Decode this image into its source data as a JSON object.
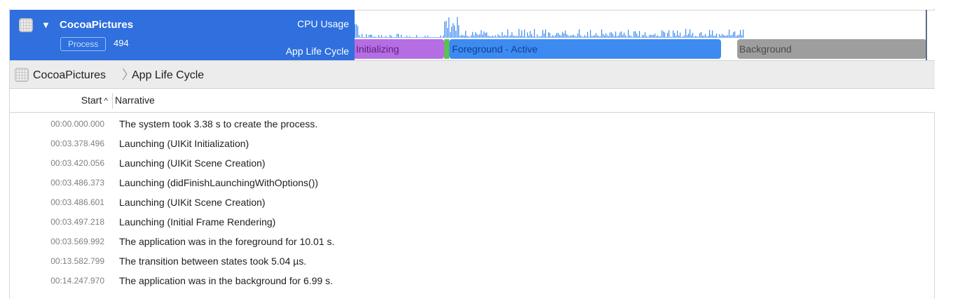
{
  "track": {
    "process_name": "CocoaPictures",
    "process_badge": "Process",
    "pid": "494",
    "cpu_lane_label": "CPU Usage",
    "lifecycle_lane_label": "App Life Cycle",
    "segments": {
      "initializing": "Initializing",
      "foreground": "Foreground - Active",
      "background": "Background"
    }
  },
  "breadcrumb": {
    "items": [
      "CocoaPictures",
      "App Life Cycle"
    ],
    "separator": "〉"
  },
  "table": {
    "columns": {
      "start": "Start",
      "narrative": "Narrative"
    },
    "sort_indicator": "^",
    "rows": [
      {
        "start": "00:00.000.000",
        "narrative": "The system took 3.38 s to create the process."
      },
      {
        "start": "00:03.378.496",
        "narrative": "Launching (UIKit Initialization)"
      },
      {
        "start": "00:03.420.056",
        "narrative": "Launching (UIKit Scene Creation)"
      },
      {
        "start": "00:03.486.373",
        "narrative": "Launching (didFinishLaunchingWithOptions())"
      },
      {
        "start": "00:03.486.601",
        "narrative": "Launching (UIKit Scene Creation)"
      },
      {
        "start": "00:03.497.218",
        "narrative": "Launching (Initial Frame Rendering)"
      },
      {
        "start": "00:03.569.992",
        "narrative": "The application was in the foreground for 10.01 s."
      },
      {
        "start": "00:13.582.799",
        "narrative": "The transition between states took 5.04 µs."
      },
      {
        "start": "00:14.247.970",
        "narrative": "The application was in the background for 6.99 s."
      }
    ]
  },
  "colors": {
    "track_header": "#2f6fde",
    "initializing": "#b56de3",
    "foreground": "#3d8bf0",
    "background": "#9e9e9e",
    "transition": "#5bc24c",
    "cpu_graph": "#3d8bf0"
  }
}
